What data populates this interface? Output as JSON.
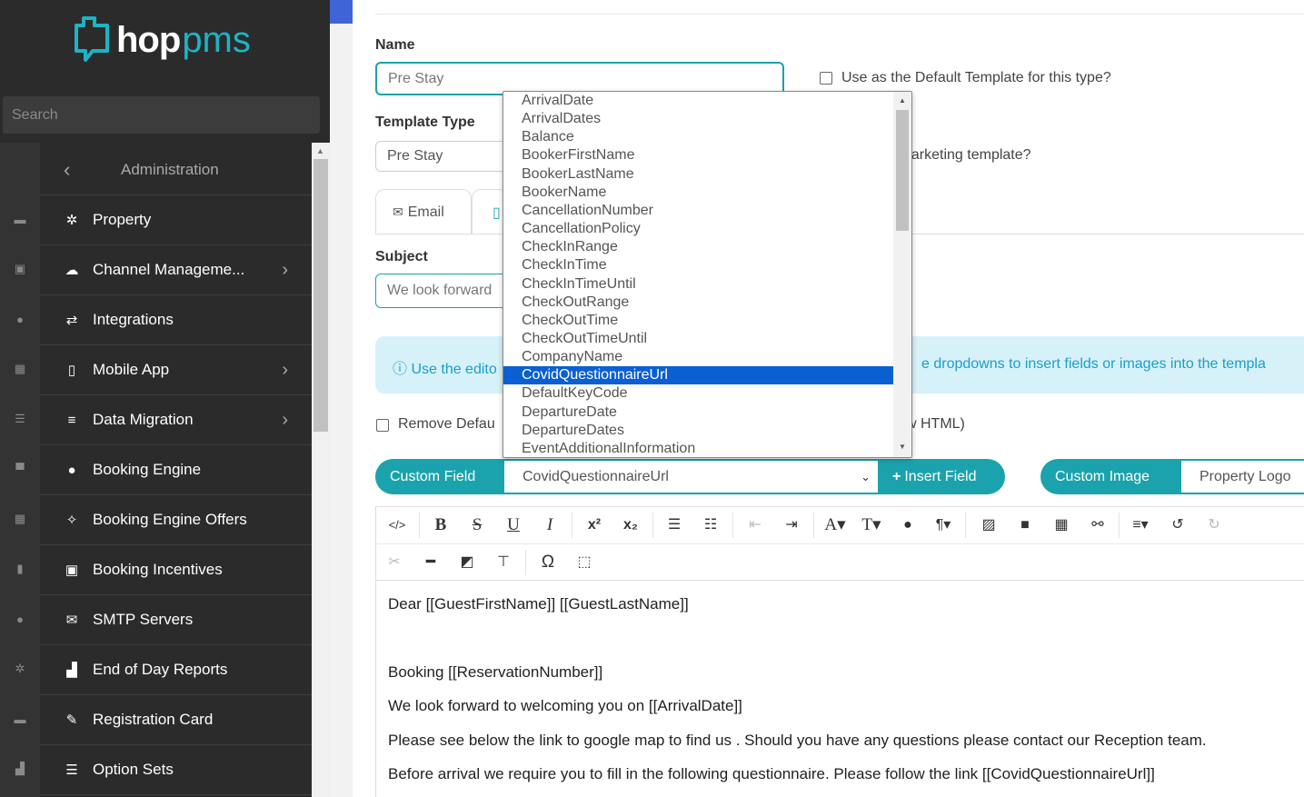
{
  "brand": {
    "hop": "hop",
    "pms": "pms",
    "accent": "#1db4c4"
  },
  "sidebar": {
    "search_placeholder": "Search",
    "back_label": "Administration",
    "items": [
      {
        "label": "Property",
        "icon": "cogs-icon",
        "has_arrow": false
      },
      {
        "label": "Channel Manageme...",
        "icon": "cloud-icon",
        "has_arrow": true
      },
      {
        "label": "Integrations",
        "icon": "exchange-icon",
        "has_arrow": false
      },
      {
        "label": "Mobile App",
        "icon": "mobile-icon",
        "has_arrow": true
      },
      {
        "label": "Data Migration",
        "icon": "database-icon",
        "has_arrow": true
      },
      {
        "label": "Booking Engine",
        "icon": "globe-icon",
        "has_arrow": false
      },
      {
        "label": "Booking Engine Offers",
        "icon": "magic-icon",
        "has_arrow": false
      },
      {
        "label": "Booking Incentives",
        "icon": "money-icon",
        "has_arrow": false
      },
      {
        "label": "SMTP Servers",
        "icon": "envelope-icon",
        "has_arrow": false
      },
      {
        "label": "End of Day Reports",
        "icon": "bar-chart-icon",
        "has_arrow": false
      },
      {
        "label": "Registration Card",
        "icon": "edit-icon",
        "has_arrow": false
      },
      {
        "label": "Option Sets",
        "icon": "list-icon",
        "has_arrow": false
      }
    ]
  },
  "form": {
    "name_label": "Name",
    "name_value": "Pre Stay",
    "default_template_label": "Use as the Default Template for this type?",
    "template_type_label": "Template Type",
    "template_type_value": "Pre Stay",
    "marketing_label": "narketing template?",
    "tabs": {
      "email": "Email"
    },
    "subject_label": "Subject",
    "subject_value": "We look forward",
    "info_left": "Use the edito",
    "info_right": "e dropdowns to insert fields or images into the templa",
    "remove_default_label": "Remove Defau",
    "remove_default_right": "w HTML)",
    "custom_field_label": "Custom Field",
    "custom_field_value": "CovidQuestionnaireUrl",
    "insert_field_label": "Insert Field",
    "custom_image_label": "Custom Image",
    "custom_image_value": "Property Logo"
  },
  "dropdown": {
    "options": [
      "ArrivalDate",
      "ArrivalDates",
      "Balance",
      "BookerFirstName",
      "BookerLastName",
      "BookerName",
      "CancellationNumber",
      "CancellationPolicy",
      "CheckInRange",
      "CheckInTime",
      "CheckInTimeUntil",
      "CheckOutRange",
      "CheckOutTime",
      "CheckOutTimeUntil",
      "CompanyName",
      "CovidQuestionnaireUrl",
      "DefaultKeyCode",
      "DepartureDate",
      "DepartureDates",
      "EventAdditionalInformation"
    ],
    "selected": "CovidQuestionnaireUrl"
  },
  "editor": {
    "lines": [
      "Dear [[GuestFirstName]]  [[GuestLastName]]",
      "Booking  [[ReservationNumber]]",
      "We look forward to welcoming you on [[ArrivalDate]]",
      "Please see below the link to google map to find us . Should you have any questions please contact our Reception team.",
      "Before arrival we require you to fill in the following questionnaire. Please follow the link [[CovidQuestionnaireUrl]]"
    ]
  },
  "colors": {
    "teal": "#1aa3ac",
    "selection": "#0a5fd3",
    "info_bg": "#d7f1f8",
    "info_text": "#1a9fc4"
  }
}
